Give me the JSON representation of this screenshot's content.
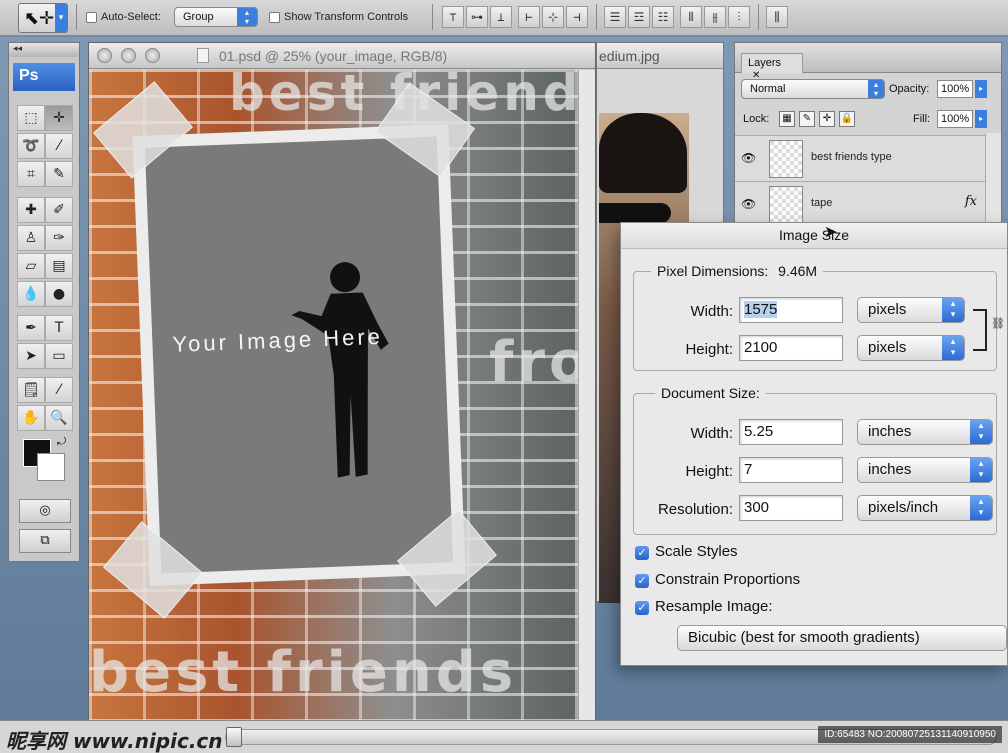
{
  "options_bar": {
    "auto_select_label": "Auto-Select:",
    "auto_select_value": "Group",
    "show_transform_label": "Show Transform Controls"
  },
  "toolbox": {
    "header": "◂◂",
    "logo": "Ps"
  },
  "document": {
    "title": "01.psd @ 25% (your_image, RGB/8)",
    "overlay_text": "Your Image Here",
    "big_text_top": "best friends",
    "big_text_bottom": "best friends",
    "big_text_side": "fror"
  },
  "second_document": {
    "title": "edium.jpg"
  },
  "layers_panel": {
    "tab_label": "Layers",
    "blend_mode": "Normal",
    "opacity_label": "Opacity:",
    "opacity_value": "100%",
    "lock_label": "Lock:",
    "fill_label": "Fill:",
    "fill_value": "100%",
    "layers": [
      {
        "name": "best friends type",
        "has_fx": false
      },
      {
        "name": "tape",
        "has_fx": true,
        "fx_label": "fx"
      }
    ]
  },
  "image_size_dialog": {
    "title": "Image Size",
    "pixel_dimensions_label": "Pixel Dimensions:",
    "pixel_dimensions_value": "9.46M",
    "pixel_width_label": "Width:",
    "pixel_width_value": "1575",
    "pixel_width_unit": "pixels",
    "pixel_height_label": "Height:",
    "pixel_height_value": "2100",
    "pixel_height_unit": "pixels",
    "document_size_label": "Document Size:",
    "doc_width_label": "Width:",
    "doc_width_value": "5.25",
    "doc_width_unit": "inches",
    "doc_height_label": "Height:",
    "doc_height_value": "7",
    "doc_height_unit": "inches",
    "resolution_label": "Resolution:",
    "resolution_value": "300",
    "resolution_unit": "pixels/inch",
    "scale_styles_label": "Scale Styles",
    "scale_styles_checked": true,
    "constrain_label": "Constrain Proportions",
    "constrain_checked": true,
    "resample_label": "Resample Image:",
    "resample_checked": true,
    "resample_method": "Bicubic (best for smooth gradients)"
  },
  "watermark": {
    "left": "昵享网 www.nipic.cn",
    "right": "ID:65483 NO:20080725131140910950"
  }
}
